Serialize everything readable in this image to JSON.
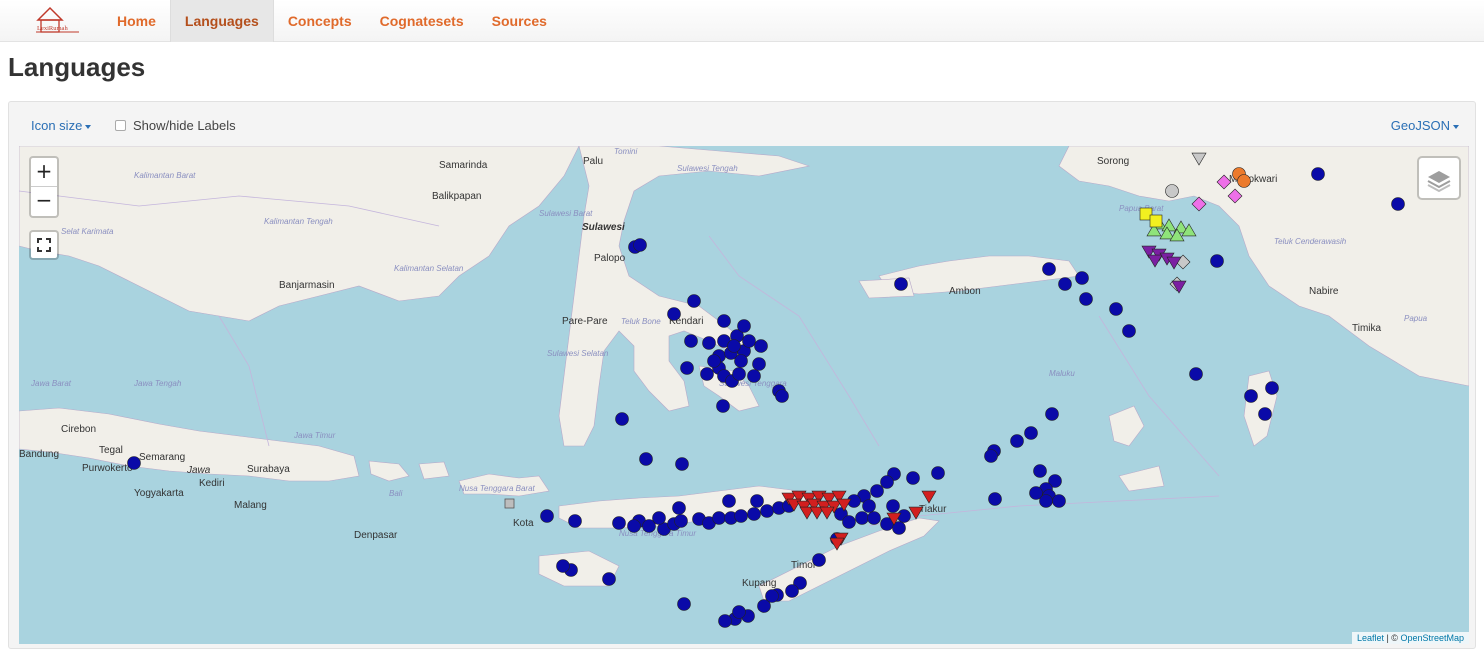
{
  "nav": {
    "brand_text": "LexiRumah",
    "items": [
      "Home",
      "Languages",
      "Concepts",
      "Cognatesets",
      "Sources"
    ],
    "active": "Languages"
  },
  "page": {
    "title": "Languages"
  },
  "toolbar": {
    "icon_size_label": "Icon size",
    "labels_toggle_label": "Show/hide Labels",
    "geojson_label": "GeoJSON"
  },
  "map": {
    "zoom_in": "+",
    "zoom_out": "−",
    "attribution_leaflet": "Leaflet",
    "attribution_sep": " | © ",
    "attribution_osm": "OpenStreetMap",
    "colors": {
      "sea": "#a9d3df",
      "land": "#f1efe9",
      "blue_marker": "#0a0aa8",
      "red_marker": "#d21f1f",
      "green_marker": "#8fe37a",
      "yellow_marker": "#f2f020",
      "pink_marker": "#ee6fe8",
      "orange_marker": "#ec7a2c",
      "purple_marker": "#7b1fa2",
      "grey_marker": "#c8c8c8"
    },
    "places": [
      "Samarinda",
      "Palu",
      "Balikpapan",
      "Sulawesi",
      "Palopo",
      "Banjarmasin",
      "Pare-Pare",
      "Kendari",
      "Ambon",
      "Sorong",
      "Manokwari",
      "Nabire",
      "Timika",
      "Cirebon",
      "Tegal",
      "Semarang",
      "Bandung",
      "Purwokerto",
      "Jawa",
      "Kediri",
      "Surabaya",
      "Yogyakarta",
      "Malang",
      "Denpasar",
      "Kota",
      "Kupang",
      "Timor",
      "Tiakur"
    ],
    "regions": [
      "Kalimantan Barat",
      "Kalimantan Tengah",
      "Kalimantan Selatan",
      "Selat Karimata",
      "Sulawesi Barat",
      "Sulawesi Tengah",
      "Sulawesi Selatan",
      "Teluk Bone",
      "Jawa Barat",
      "Jawa Tengah",
      "Jawa Timur",
      "Bali",
      "Nusa Tenggara Barat",
      "Nusa Tenggara Timur",
      "Sulawesi Tenggara",
      "Maluku",
      "Papua",
      "Tomini",
      "Teluk Cenderawasih",
      "Papua Barat"
    ]
  }
}
